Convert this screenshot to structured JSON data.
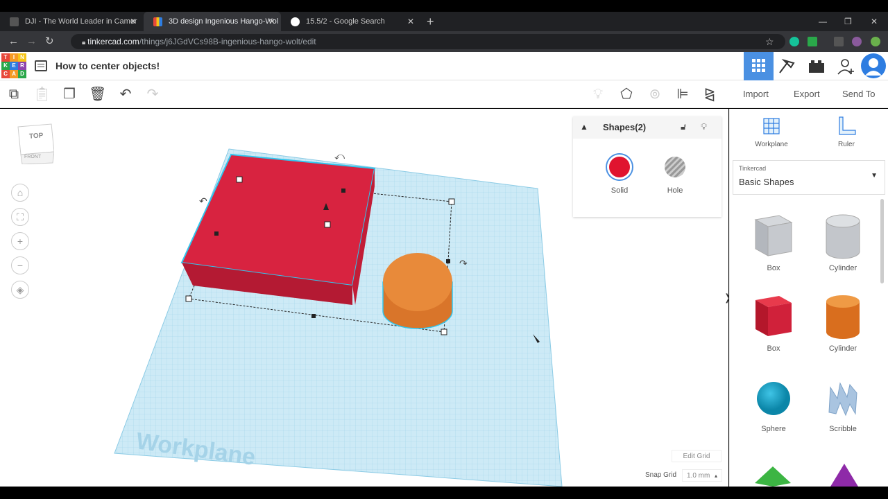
{
  "browser": {
    "tabs": [
      {
        "label": "DJI - The World Leader in Camer",
        "icon": "dji-icon",
        "active": false
      },
      {
        "label": "3D design Ingenious Hango-Wol",
        "icon": "tinkercad-icon",
        "active": true
      },
      {
        "label": "15.5/2 - Google Search",
        "icon": "google-icon",
        "active": false
      }
    ],
    "new_tab": "+",
    "url_host": "tinkercad.com",
    "url_path": "/things/j6JGdVCs98B-ingenious-hango-wolt/edit"
  },
  "app": {
    "logo_letters": [
      "T",
      "I",
      "N",
      "K",
      "E",
      "R",
      "C",
      "A",
      "D"
    ],
    "logo_colors": [
      "#e8483a",
      "#f59a23",
      "#f5c518",
      "#2aa84a",
      "#2e7de1",
      "#8e44ad",
      "#e8483a",
      "#f59a23",
      "#2aa84a"
    ],
    "design_title": "How to center objects!"
  },
  "toolbar": {
    "import_label": "Import",
    "export_label": "Export",
    "send_to_label": "Send To"
  },
  "viewcube": {
    "top": "TOP",
    "front": "FRONT"
  },
  "inspector": {
    "title": "Shapes(2)",
    "solid_label": "Solid",
    "hole_label": "Hole",
    "solid_color": "#e0142f"
  },
  "workplane": {
    "label": "Workplane",
    "edit_grid_label": "Edit Grid",
    "snap_grid_label": "Snap Grid",
    "snap_grid_value": "1.0 mm"
  },
  "right_panel": {
    "workplane_label": "Workplane",
    "ruler_label": "Ruler",
    "library_small": "Tinkercad",
    "library_name": "Basic Shapes",
    "shapes": [
      {
        "label": "Box",
        "icon": "box-hole-icon"
      },
      {
        "label": "Cylinder",
        "icon": "cylinder-hole-icon"
      },
      {
        "label": "Box",
        "icon": "box-solid-icon"
      },
      {
        "label": "Cylinder",
        "icon": "cylinder-solid-icon"
      },
      {
        "label": "Sphere",
        "icon": "sphere-icon"
      },
      {
        "label": "Scribble",
        "icon": "scribble-icon"
      }
    ]
  }
}
